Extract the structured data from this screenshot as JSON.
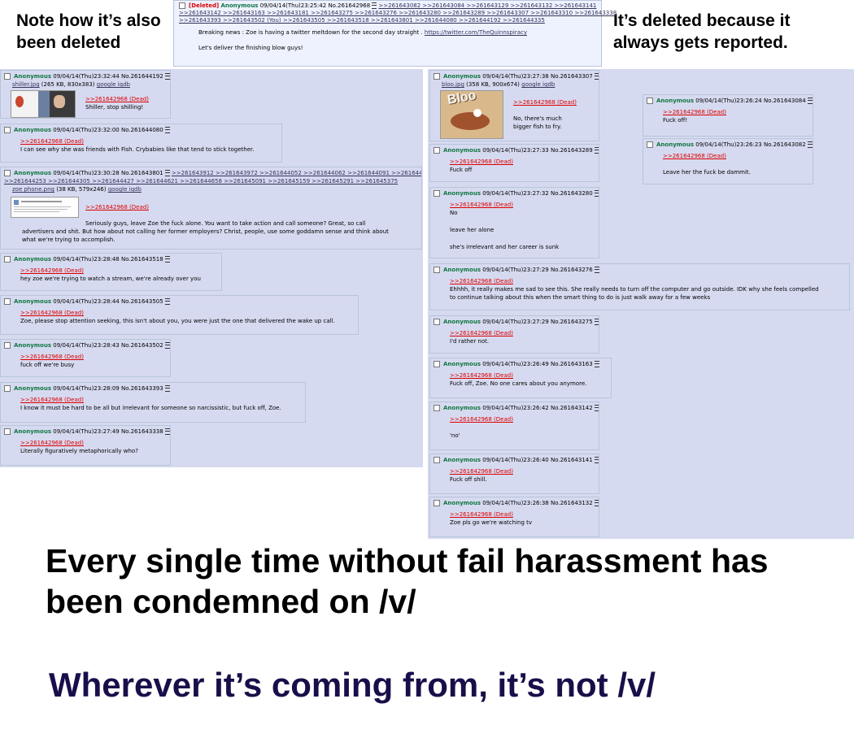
{
  "captions": {
    "top_left": "Note how it’s also been deleted",
    "top_right": "It’s deleted because it always gets reported.",
    "bottom_1": "Every single time without fail harassment has been condemned on /v/",
    "bottom_2": "Wherever it’s coming from, it’s not /v/"
  },
  "op": {
    "deleted_tag": "[Deleted]",
    "name": "Anonymous",
    "datetime": "09/04/14(Thu)23:25:42",
    "no": "No.261642968",
    "replies_1": ">>261643082 >>261643084 >>261643129 >>261643132 >>261643141",
    "replies_2": ">>261643142 >>261643163 >>261643181 >>261643275 >>261643276 >>261643280 >>261643289 >>261643307 >>261643310 >>261643338",
    "replies_3": ">>261643393 >>261643502 (You) >>261643505 >>261643518 >>261643801 >>261644080 >>261644192 >>261644335",
    "text_1": "Breaking news : Zoe is having a twitter meltdown for the second day straight . ",
    "link": "https://twitter.com/TheQuinnspiracy",
    "text_2": "Let's deliver the finishing blow guys!"
  },
  "left_posts": [
    {
      "name": "Anonymous",
      "datetime": "09/04/14(Thu)23:32:44",
      "no": "No.261644192",
      "file": "shiller.jpg",
      "fileinfo": "(265 KB, 830x383)",
      "search": "google iqdb",
      "quote": ">>261642968 (Dead)",
      "text": "Shiller, stop shilling!"
    },
    {
      "name": "Anonymous",
      "datetime": "09/04/14(Thu)23:32:00",
      "no": "No.261644080",
      "quote": ">>261642968 (Dead)",
      "text": "I can see why she was friends with Fish. Crybabies like that tend to stick together."
    },
    {
      "name": "Anonymous",
      "datetime": "09/04/14(Thu)23:30:28",
      "no": "No.261643801",
      "backlinks": ">>261643912 >>261643972 >>261644052 >>261644062 >>261644091 >>261644148",
      "backlinks_2": ">>261644253 >>261644305 >>261644427 >>261644621 >>261644658 >>261645091 >>261645159 >>261645291 >>261645375",
      "file": "zoe phone.png",
      "fileinfo": "(38 KB, 579x246)",
      "search": "google iqdb",
      "quote": ">>261642968 (Dead)",
      "text_1": "Seriously guys, leave Zoe the fuck alone. You want to take action and call someone? Great, so call",
      "text_2": "advertisers and shit. But how about not calling her former employers? Christ, people, use some goddamn sense and think about",
      "text_3": "what we're trying to accomplish."
    },
    {
      "name": "Anonymous",
      "datetime": "09/04/14(Thu)23:28:48",
      "no": "No.261643518",
      "quote": ">>261642968 (Dead)",
      "text": "hey zoe we're trying to watch a stream, we're already over you"
    },
    {
      "name": "Anonymous",
      "datetime": "09/04/14(Thu)23:28:44",
      "no": "No.261643505",
      "quote": ">>261642968 (Dead)",
      "text": "Zoe, please stop attention seeking, this isn't about you, you were just the one that delivered the wake up call."
    },
    {
      "name": "Anonymous",
      "datetime": "09/04/14(Thu)23:28:43",
      "no": "No.261643502",
      "quote": ">>261642968 (Dead)",
      "text": "fuck off we're busy"
    },
    {
      "name": "Anonymous",
      "datetime": "09/04/14(Thu)23:28:09",
      "no": "No.261643393",
      "quote": ">>261642968 (Dead)",
      "text": "I know it must be hard to be all but irrelevant for someone so narcissistic, but fuck off, Zoe."
    },
    {
      "name": "Anonymous",
      "datetime": "09/04/14(Thu)23:27:49",
      "no": "No.261643338",
      "quote": ">>261642968 (Dead)",
      "text": "Literally figuratively metaphorically who?"
    }
  ],
  "mid_posts": [
    {
      "name": "Anonymous",
      "datetime": "09/04/14(Thu)23:27:38",
      "no": "No.261643307",
      "file": "bloo.jpg",
      "fileinfo": "(358 KB, 900x674)",
      "search": "google iqdb",
      "quote": ">>261642968 (Dead)",
      "text_1": "No, there's much",
      "text_2": "bigger fish to fry."
    },
    {
      "name": "Anonymous",
      "datetime": "09/04/14(Thu)23:27:33",
      "no": "No.261643289",
      "quote": ">>261642968 (Dead)",
      "text": "Fuck off"
    },
    {
      "name": "Anonymous",
      "datetime": "09/04/14(Thu)23:27:32",
      "no": "No.261643280",
      "quote": ">>261642968 (Dead)",
      "text_1": "No",
      "text_2": "leave her alone",
      "text_3": "she's irrelevant and her career is sunk"
    },
    {
      "name": "Anonymous",
      "datetime": "09/04/14(Thu)23:27:29",
      "no": "No.261643276",
      "quote": ">>261642968 (Dead)",
      "text_1": "Ehhhh, it really makes me sad to see this. She really needs to turn off the computer and go outside. IDK why she feels compelled",
      "text_2": "to continue talking about this when the smart thing to do is just walk away for a few weeks"
    },
    {
      "name": "Anonymous",
      "datetime": "09/04/14(Thu)23:27:29",
      "no": "No.261643275",
      "quote": ">>261642968 (Dead)",
      "text": "I'd rather not."
    },
    {
      "name": "Anonymous",
      "datetime": "09/04/14(Thu)23:26:49",
      "no": "No.261643163",
      "quote": ">>261642968 (Dead)",
      "text": "Fuck off, Zoe. No one cares about you anymore."
    },
    {
      "name": "Anonymous",
      "datetime": "09/04/14(Thu)23:26:42",
      "no": "No.261643142",
      "quote": ">>261642968 (Dead)",
      "text": "'no'"
    },
    {
      "name": "Anonymous",
      "datetime": "09/04/14(Thu)23:26:40",
      "no": "No.261643141",
      "quote": ">>261642968 (Dead)",
      "text": "Fuck off shill."
    },
    {
      "name": "Anonymous",
      "datetime": "09/04/14(Thu)23:26:38",
      "no": "No.261643132",
      "quote": ">>261642968 (Dead)",
      "text": "Zoe pls go we're watching tv"
    }
  ],
  "right_posts": [
    {
      "name": "Anonymous",
      "datetime": "09/04/14(Thu)23:26:24",
      "no": "No.261643084",
      "quote": ">>261642968 (Dead)",
      "text": "Fuck off!"
    },
    {
      "name": "Anonymous",
      "datetime": "09/04/14(Thu)23:26:23",
      "no": "No.261643082",
      "quote": ">>261642968 (Dead)",
      "text": "Leave her the fuck be dammit."
    }
  ],
  "thumb_bloo_text": "Bloo"
}
